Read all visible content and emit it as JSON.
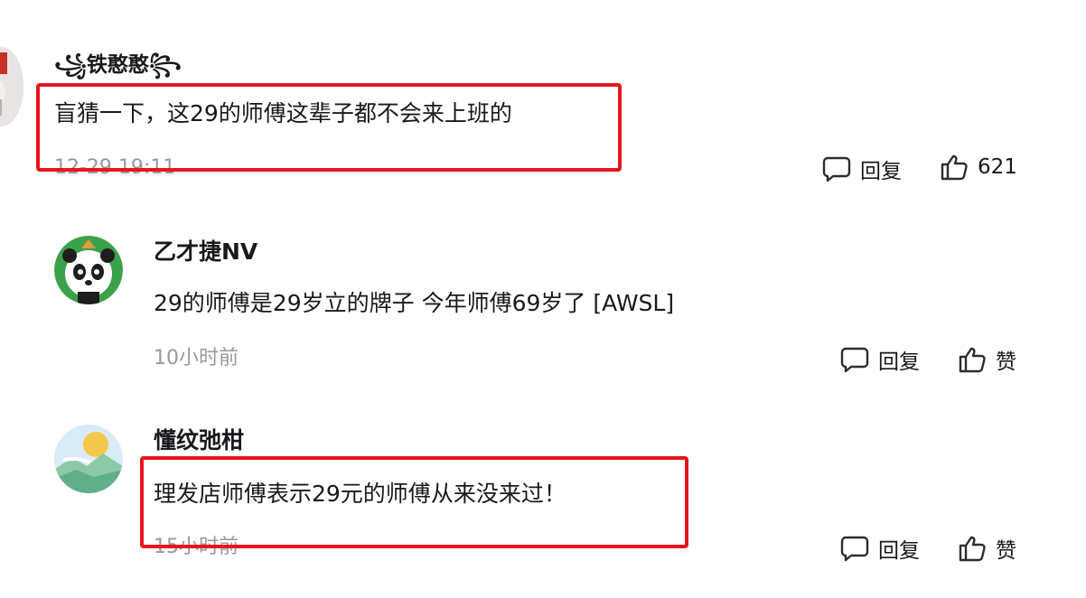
{
  "comments": [
    {
      "username": "꧁铁憨憨꧂",
      "content": "盲猜一下，这29的师傅这辈子都不会来上班的",
      "time": "12-29 19:11",
      "reply_label": "回复",
      "like_label": "621"
    },
    {
      "username": "乙才捷NV",
      "content": "29的师傅是29岁立的牌子 今年师傅69岁了 [AWSL]",
      "time": "10小时前",
      "reply_label": "回复",
      "like_label": "赞"
    },
    {
      "username": "懂纹弛柑",
      "content": "理发店师傅表示29元的师傅从来没来过！",
      "time": "15小时前",
      "reply_label": "回复",
      "like_label": "赞"
    }
  ],
  "icons": {
    "reply": "comment-bubble-icon",
    "like": "thumbs-up-icon"
  },
  "colors": {
    "highlight": "#e8141b",
    "text": "#18191c",
    "muted": "#9499a0"
  }
}
